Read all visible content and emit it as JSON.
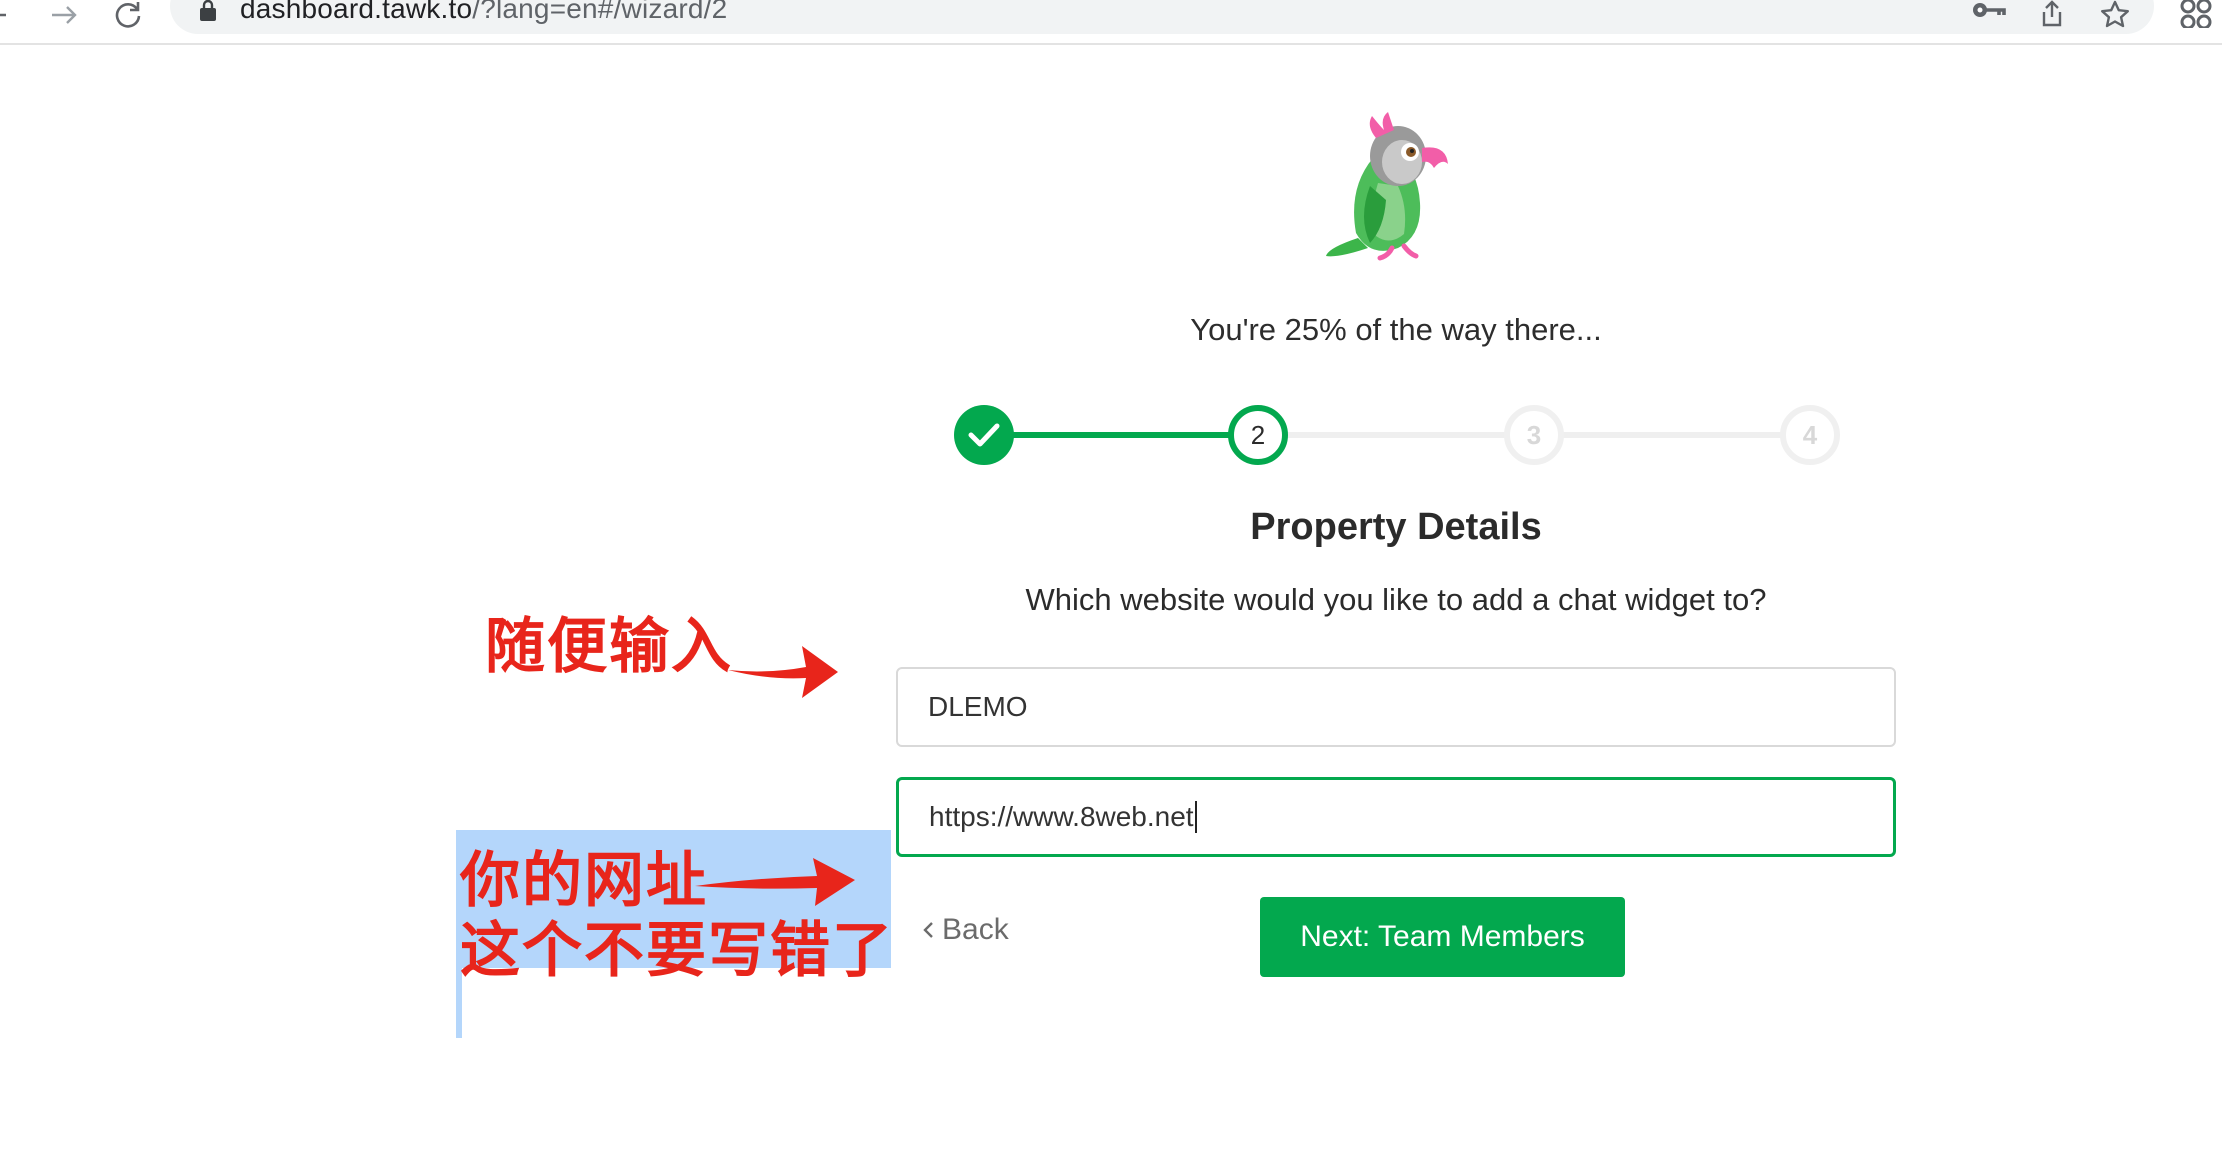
{
  "browser": {
    "url_domain": "dashboard.tawk.to",
    "url_path": "/?lang=en#/wizard/2"
  },
  "wizard": {
    "progress_text": "You're 25% of the way there...",
    "progress_fraction": 0.25,
    "steps": [
      {
        "label": "",
        "state": "done"
      },
      {
        "label": "2",
        "state": "current"
      },
      {
        "label": "3",
        "state": "todo"
      },
      {
        "label": "4",
        "state": "todo"
      }
    ],
    "title": "Property Details",
    "question": "Which website would you like to add a chat widget to?",
    "fields": {
      "property_name": "DLEMO",
      "website_url": "https://www.8web.net"
    },
    "back_label": "Back",
    "next_label": "Next: Team Members"
  },
  "annotations": {
    "top_note": "随便输入",
    "bottom_note_line1": "你的网址",
    "bottom_note_line2": "这个不要写错了"
  },
  "colors": {
    "accent_green": "#03a84e",
    "annotation_red": "#e8251b",
    "highlight_blue": "#b4d6fb"
  },
  "icons": {
    "lock": "lock-icon",
    "key": "key-icon",
    "share": "share-icon",
    "star": "star-icon",
    "extension": "extension-icon",
    "check": "check-icon",
    "chevron_left": "chevron-left-icon",
    "logo": "parrot-logo"
  }
}
